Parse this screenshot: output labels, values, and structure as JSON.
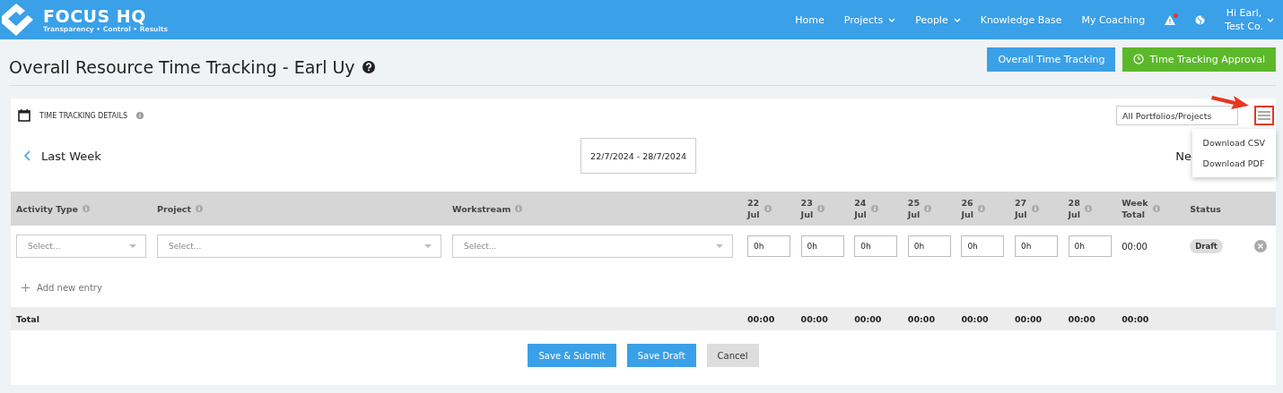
{
  "brand": {
    "name": "FOCUS HQ",
    "tagline": "Transparency • Control • Results"
  },
  "nav": [
    {
      "label": "Home",
      "dropdown": false
    },
    {
      "label": "Projects",
      "dropdown": true
    },
    {
      "label": "People",
      "dropdown": true
    },
    {
      "label": "Knowledge Base",
      "dropdown": false
    },
    {
      "label": "My Coaching",
      "dropdown": false
    }
  ],
  "user": {
    "greeting": "Hi Earl,",
    "company": "Test Co."
  },
  "page_title": "Overall Resource Time Tracking - Earl Uy",
  "header_buttons": [
    {
      "label": "Overall Time Tracking",
      "kind": "primary"
    },
    {
      "label": "Time Tracking Approval",
      "kind": "approve"
    }
  ],
  "card": {
    "title": "TIME TRACKING DETAILS",
    "filter": {
      "value": "All Portfolios/Projects"
    },
    "menu": {
      "items": [
        "Download CSV",
        "Download PDF"
      ]
    },
    "prev_label": "Last Week",
    "date_range": "22/7/2024 - 28/7/2024",
    "next_label": "Ne"
  },
  "table": {
    "columns": [
      {
        "label": "Activity Type",
        "info": true
      },
      {
        "label": "Project",
        "info": true
      },
      {
        "label": "Workstream",
        "info": true
      },
      {
        "label": "22\nJul",
        "info": true
      },
      {
        "label": "23\nJul",
        "info": true
      },
      {
        "label": "24\nJul",
        "info": true
      },
      {
        "label": "25\nJul",
        "info": true
      },
      {
        "label": "26\nJul",
        "info": true
      },
      {
        "label": "27\nJul",
        "info": true
      },
      {
        "label": "28\nJul",
        "info": true
      },
      {
        "label": "Week\nTotal",
        "info": true
      },
      {
        "label": "Status",
        "info": false
      }
    ],
    "rows": [
      {
        "selects": [
          {
            "placeholder": "Select..."
          },
          {
            "placeholder": "Select..."
          },
          {
            "placeholder": "Select..."
          }
        ],
        "hours": [
          "0h",
          "0h",
          "0h",
          "0h",
          "0h",
          "0h",
          "0h"
        ],
        "week_total": "00:00",
        "status": "Draft"
      }
    ],
    "add_entry": "Add new entry",
    "total": {
      "label": "Total",
      "values": [
        "00:00",
        "00:00",
        "00:00",
        "00:00",
        "00:00",
        "00:00",
        "00:00",
        "00:00"
      ]
    }
  },
  "footer_buttons": [
    {
      "label": "Save & Submit",
      "kind": "primary"
    },
    {
      "label": "Save Draft",
      "kind": "primary"
    },
    {
      "label": "Cancel",
      "kind": "secondary"
    }
  ]
}
